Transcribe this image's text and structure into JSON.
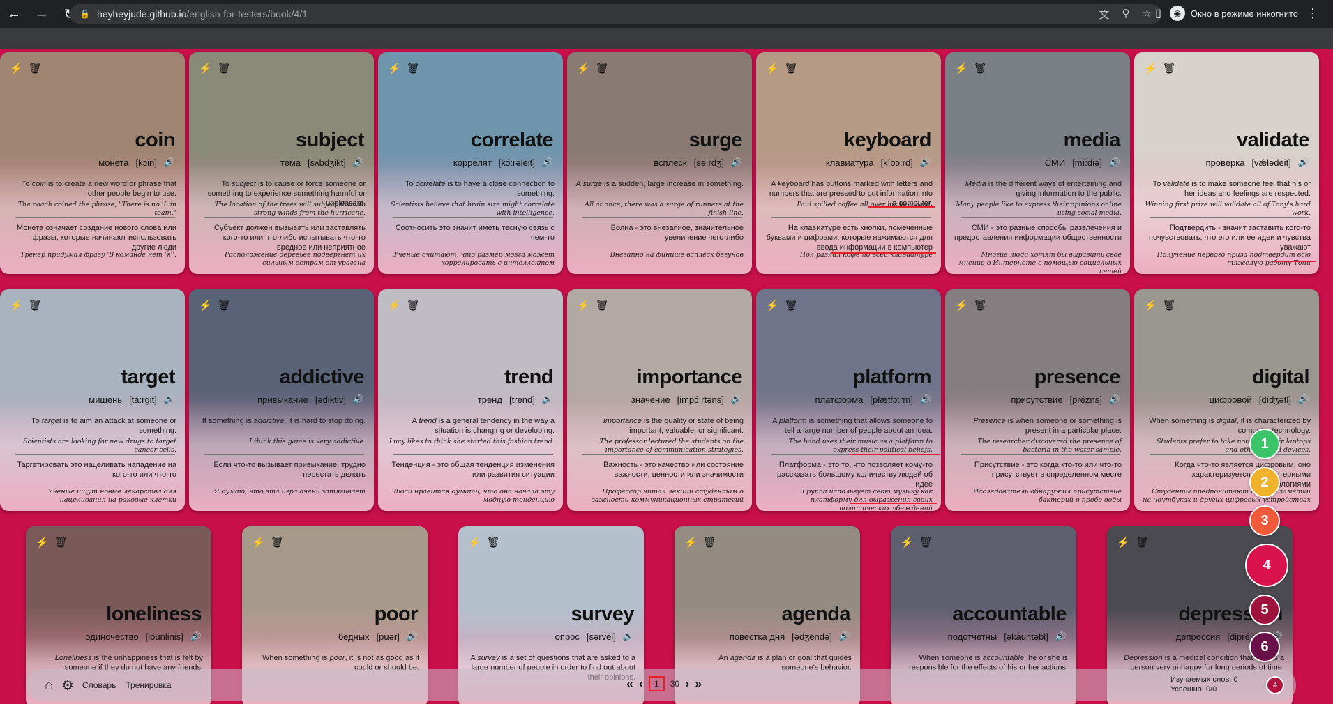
{
  "browser": {
    "url_host": "heyheyjude.github.io",
    "url_path": "/english-for-testers/book/4/1",
    "incognito_label": "Окно в режиме инкогнито"
  },
  "cards": [
    {
      "word": "coin",
      "ru": "монета",
      "ipa": "[kɔin]",
      "def_pre": "To ",
      "def_term": "coin",
      "def_post": " is to create a new word or phrase that other people begin to use.",
      "example": "The coach coined the phrase, \"There is no 'I' in team.\"",
      "ru_def": "Монета означает создание нового слова или фразы, которые начинают использовать другие люди",
      "ru_example": "Тренер придумал фразу 'В команде нет 'я''.",
      "photo": "#a08572"
    },
    {
      "word": "subject",
      "ru": "тема",
      "ipa": "[sʌbdʒikt]",
      "def_pre": "To ",
      "def_term": "subject",
      "def_post": " is to cause or force someone or something to experience something harmful or unpleasant.",
      "example": "The location of the trees will subject them to strong winds from the hurricane.",
      "ru_def": "Субъект должен вызывать или заставлять кого-то или что-либо испытывать что-то вредное или неприятное",
      "ru_example": "Расположение деревьев подвергнет их сильным ветрам от урагана",
      "photo": "#8a8a78"
    },
    {
      "word": "correlate",
      "ru": "коррелят",
      "ipa": "[kɔ́:rəlèit]",
      "def_pre": "To ",
      "def_term": "correlate",
      "def_post": " is to have a close connection to something.",
      "example": "Scientists believe that brain size might correlate with intelligence.",
      "ru_def": "Соотносить это значит иметь тесную связь с чем-то",
      "ru_example": "Ученые считают, что размер мозга может коррелировать с интеллектом",
      "photo": "#6f95ad"
    },
    {
      "word": "surge",
      "ru": "всплеск",
      "ipa": "[sə:rdʒ]",
      "def_pre": "A ",
      "def_term": "surge",
      "def_post": " is a sudden, large increase in something.",
      "example": "All at once, there was a surge of runners at the finish line.",
      "ru_def": "Волна - это внезапное, значительное увеличение чего-либо",
      "ru_example": "Внезапно на финише всплеск бегунов",
      "photo": "#8a7a74"
    },
    {
      "word": "keyboard",
      "ru": "клавиатура",
      "ipa": "[kíbɔ:rd]",
      "def_pre": "A ",
      "def_term": "keyboard",
      "def_post": " has buttons marked with letters and numbers that are pressed to put information into a computer.",
      "example": "Paul spilled coffee all over his keyboard.",
      "ru_def": "На клавиатуре есть кнопки, помеченные буквами и цифрами, которые нажимаются для ввода информации в компьютер",
      "ru_example": "Пол разлил кофе по всей клавиатуре",
      "photo": "#b59a86"
    },
    {
      "word": "media",
      "ru": "СМИ",
      "ipa": "[mí:diə]",
      "def_pre": "",
      "def_term": "Media",
      "def_post": " is the different ways of entertaining and giving information to the public.",
      "example": "Many people like to express their opinions online using social media.",
      "ru_def": "СМИ - это разные способы развлечения и предоставления информации общественности",
      "ru_example": "Многие люди хотят бы выразить свое мнение в Интернете с помощью социальных сетей",
      "photo": "#7b7f86"
    },
    {
      "word": "validate",
      "ru": "проверка",
      "ipa": "[vǽlədèit]",
      "def_pre": "To ",
      "def_term": "validate",
      "def_post": " is to make someone feel that his or her ideas and feelings are respected.",
      "example": "Winning first prize will validate all of Tony's hard work.",
      "ru_def": "Подтвердить - значит заставить кого-то почувствовать, что его или ее идеи и чувства уважают",
      "ru_example": "Получение первого приза подтвердит всю тяжелую работу Тони",
      "photo": "#d8d2cc"
    },
    {
      "word": "target",
      "ru": "мишень",
      "ipa": "[tá:rgit]",
      "def_pre": "To ",
      "def_term": "target",
      "def_post": " is to aim an attack at someone or something.",
      "example": "Scientists are looking for new drugs to target cancer cells.",
      "ru_def": "Таргетировать это нацеливать нападение на кого-то или что-то",
      "ru_example": "Ученые ищут новые лекарства для нацеливания на раковые клетки",
      "photo": "#a9b3c0"
    },
    {
      "word": "addictive",
      "ru": "привыкание",
      "ipa": "[ədiktiv]",
      "def_pre": "If something is ",
      "def_term": "addictive",
      "def_post": ", it is hard to stop doing.",
      "example": "I think this game is very addictive.",
      "ru_def": "Если что-то вызывает привыкание, трудно перестать делать",
      "ru_example": "Я думаю, что эта игра очень затягивает",
      "photo": "#5a6278"
    },
    {
      "word": "trend",
      "ru": "тренд",
      "ipa": "[trend]",
      "def_pre": "A ",
      "def_term": "trend",
      "def_post": " is a general tendency in the way a situation is changing or developing.",
      "example": "Lucy likes to think she started this fashion trend.",
      "ru_def": "Тенденция - это общая тенденция изменения или развития ситуации",
      "ru_example": "Люси нравится думать, что она начала эту модную тенденцию",
      "photo": "#c0bcc4"
    },
    {
      "word": "importance",
      "ru": "значение",
      "ipa": "[impɔ́:rtəns]",
      "def_pre": "",
      "def_term": "Importance",
      "def_post": " is the quality or state of being important, valuable, or significant.",
      "example": "The professor lectured the students on the importance of communication strategies.",
      "ru_def": "Важность - это качество или состояние важности, ценности или значимости",
      "ru_example": "Профессор читал лекции студентам о важности коммуникационных стратегий",
      "photo": "#b2a8a4"
    },
    {
      "word": "platform",
      "ru": "платформа",
      "ipa": "[plǽtfɔ:rm]",
      "def_pre": "A ",
      "def_term": "platform",
      "def_post": " is something that allows someone to tell a large number of people about an idea.",
      "example": "The band uses their music as a platform to express their political beliefs.",
      "ru_def": "Платформа - это то, что позволяет кому-то рассказать большому количеству людей об идее",
      "ru_example": "Группа использует свою музыку как платформу для выражения своих политических убеждений",
      "photo": "#6f748a"
    },
    {
      "word": "presence",
      "ru": "присутствие",
      "ipa": "[prézns]",
      "def_pre": "",
      "def_term": "Presence",
      "def_post": " is when someone or something is present in a particular place.",
      "example": "The researcher discovered the presence of bacteria in the water sample.",
      "ru_def": "Присутствие - это когда кто-то или что-то присутствует в определенном месте",
      "ru_example": "Исследователь обнаружил присутствие бактерий в пробе воды",
      "photo": "#857e80"
    },
    {
      "word": "digital",
      "ru": "цифровой",
      "ipa": "[dídʒətl]",
      "def_pre": "When something is ",
      "def_term": "digital",
      "def_post": ", it is characterized by computer technology.",
      "example": "Students prefer to take notes on their laptops and other digital devices.",
      "ru_def": "Когда что-то является цифровым, оно характеризуется компьютерными технологиями",
      "ru_example": "Студенты предпочитают делать заметки на ноутбуках и других цифровых устройствах",
      "photo": "#9a9690"
    },
    {
      "word": "loneliness",
      "ru": "одиночество",
      "ipa": "[lóunlinis]",
      "def_pre": "",
      "def_term": "Loneliness",
      "def_post": " is the unhappiness that is felt by someone if they do not have any friends.",
      "example": "",
      "ru_def": "",
      "ru_example": "",
      "photo": "#7a5a58"
    },
    {
      "word": "poor",
      "ru": "бедных",
      "ipa": "[puər]",
      "def_pre": "When something is ",
      "def_term": "poor",
      "def_post": ", it is not as good as it could or should be.",
      "example": "",
      "ru_def": "",
      "ru_example": "",
      "photo": "#a89a8a"
    },
    {
      "word": "survey",
      "ru": "опрос",
      "ipa": "[sərvéi]",
      "def_pre": "A ",
      "def_term": "survey",
      "def_post": " is a set of questions that are asked to a large number of people in order to find out about their opinions.",
      "example": "",
      "ru_def": "",
      "ru_example": "",
      "photo": "#b4c0cc"
    },
    {
      "word": "agenda",
      "ru": "повестка дня",
      "ipa": "[ədʒéndə]",
      "def_pre": "An ",
      "def_term": "agenda",
      "def_post": " is a plan or goal that guides someone's behavior.",
      "example": "",
      "ru_def": "",
      "ru_example": "",
      "photo": "#948c82"
    },
    {
      "word": "accountable",
      "ru": "подотчетны",
      "ipa": "[əkáuntəbl]",
      "def_pre": "When someone is ",
      "def_term": "accountable",
      "def_post": ", he or she is responsible for the effects of his or her actions.",
      "example": "",
      "ru_def": "",
      "ru_example": "",
      "photo": "#5e6070"
    },
    {
      "word": "depression",
      "ru": "депрессия",
      "ipa": "[dipréʃən]",
      "def_pre": "",
      "def_term": "Depression",
      "def_post": " is a medical condition that makes a person very unhappy for long periods of time.",
      "example": "",
      "ru_def": "",
      "ru_example": "",
      "photo": "#4a4a50"
    }
  ],
  "bottom": {
    "dictionary": "Словарь",
    "training": "Тренировка",
    "current_page": "1",
    "total_pages": "30",
    "studied": "Изучаемых слов: 0",
    "success": "Успешно: 0/0",
    "mini_level": "4"
  },
  "levels": [
    {
      "label": "1",
      "color": "#3cc46a"
    },
    {
      "label": "2",
      "color": "#f0b22a"
    },
    {
      "label": "3",
      "color": "#f05a3a"
    },
    {
      "label": "4",
      "color": "#d9134d"
    },
    {
      "label": "5",
      "color": "#a0123e"
    },
    {
      "label": "6",
      "color": "#6a1048"
    }
  ]
}
